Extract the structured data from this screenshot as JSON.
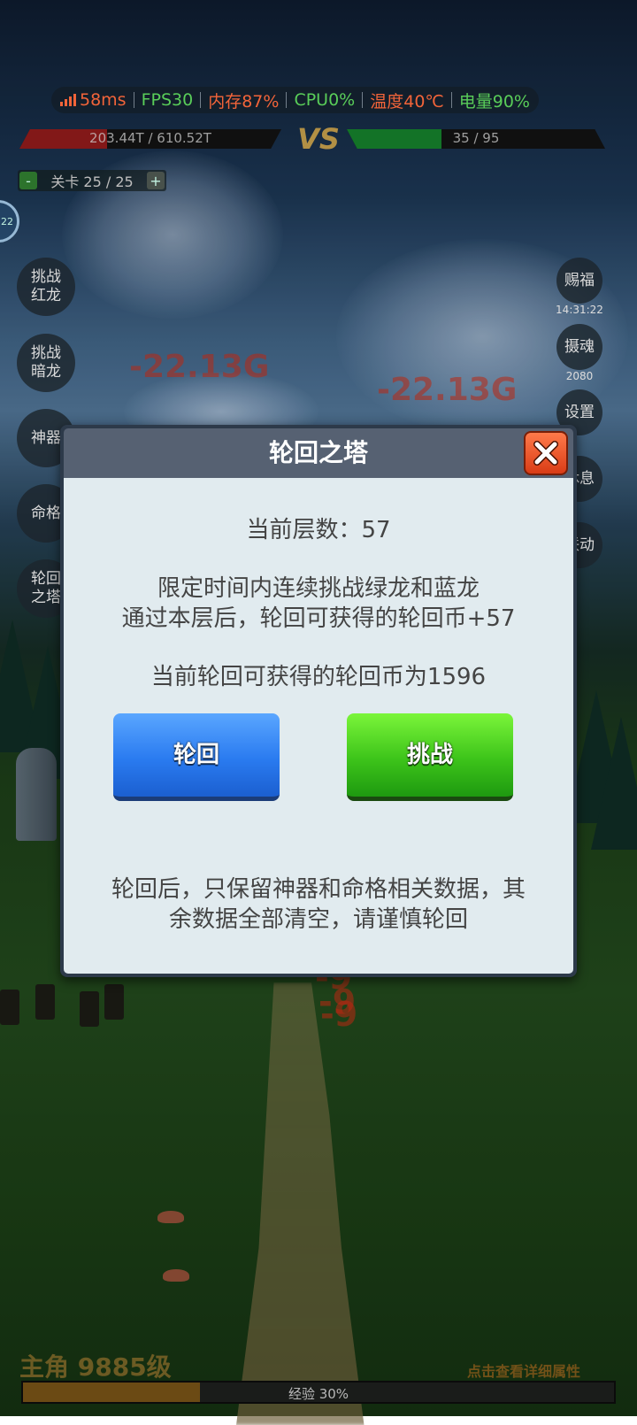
{
  "status_bar": {
    "ping": "58ms",
    "fps": "FPS30",
    "memory": "内存87%",
    "cpu": "CPU0%",
    "temperature": "温度40℃",
    "battery": "电量90%",
    "colors": {
      "ping": "#ff6a3d",
      "fps": "#5ed85e",
      "memory": "#ff6a3d",
      "cpu": "#5ed85e",
      "temperature": "#ff6a3d",
      "battery": "#5ed85e"
    }
  },
  "battle": {
    "player_hp": "203.44T / 610.52T",
    "player_hp_fraction": 0.333,
    "vs": "VS",
    "enemy_hp": "35 / 95",
    "enemy_hp_fraction": 0.368
  },
  "stage": {
    "minus": "-",
    "label": "关卡 25 / 25",
    "plus": "+"
  },
  "avatar_badge": "22",
  "left_menu": [
    "挑战红龙",
    "挑战暗龙",
    "神器",
    "命格",
    "轮回之塔"
  ],
  "right_menu": {
    "blessing": "赐福",
    "blessing_time": "14:31:22",
    "soul": "摄魂",
    "soul_count": "2080",
    "settings": "设置",
    "rest": "休息",
    "link": "联动"
  },
  "damage_numbers": [
    "-22.13G",
    "-22.13G",
    "-9",
    "-9",
    "-9"
  ],
  "dialog": {
    "title": "轮回之塔",
    "floor": "当前层数：57",
    "desc_line1": "限定时间内连续挑战绿龙和蓝龙",
    "desc_line2": "通过本层后，轮回可获得的轮回币+57",
    "current_coins": "当前轮回可获得的轮回币为1596",
    "btn_reincarnate": "轮回",
    "btn_challenge": "挑战",
    "warning_line1": "轮回后，只保留神器和命格相关数据，其",
    "warning_line2": "余数据全部清空，请谨慎轮回"
  },
  "bottom": {
    "hero_level": "主角 9885级",
    "detail_link": "点击查看详细属性",
    "exp_label": "经验 30%",
    "exp_fraction": 0.3
  }
}
